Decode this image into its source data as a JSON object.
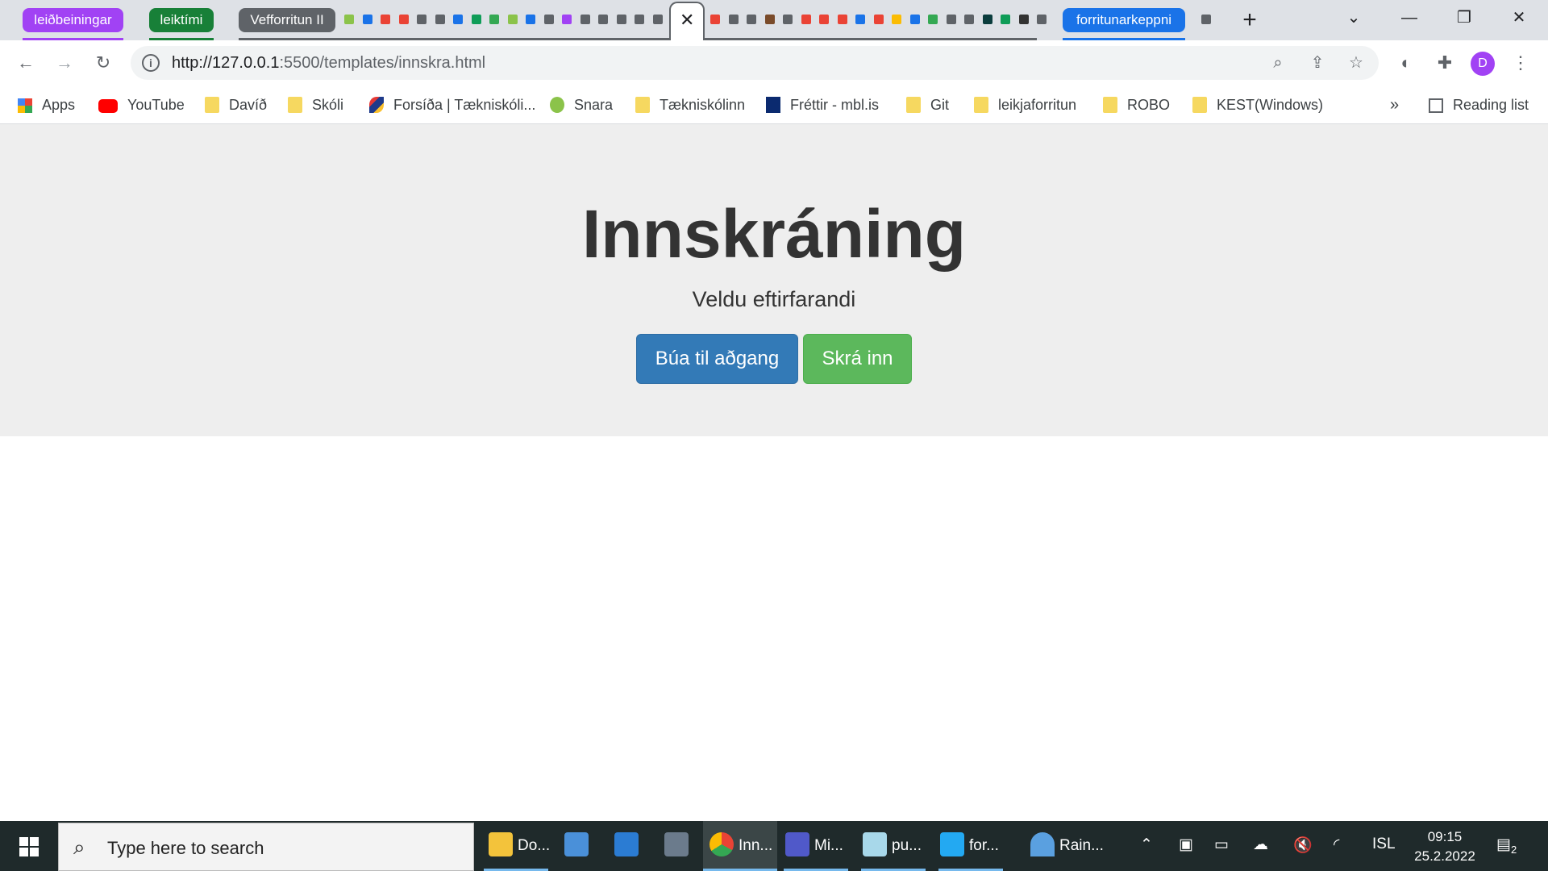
{
  "tab_groups": [
    {
      "label": "leiðbeiningar",
      "color": "#a142f4"
    },
    {
      "label": "leiktími",
      "color": "#188038"
    },
    {
      "label": "Vefforritun II",
      "color": "#5f6368"
    },
    {
      "label": "forritunarkeppni",
      "color": "#1a73e8"
    }
  ],
  "window_controls": {
    "tab_search": "⌄",
    "minimize": "—",
    "restore": "❐",
    "close": "✕"
  },
  "active_tab_close": "✕",
  "new_tab": "+",
  "toolbar": {
    "back": "←",
    "forward": "→",
    "reload": "↻",
    "url_host": "http://127.0.0.1",
    "url_rest": ":5500/templates/innskra.html",
    "avatar_letter": "D",
    "menu": "⋮"
  },
  "bookmarks": [
    {
      "label": "Apps",
      "icon": "apps-grid-icon"
    },
    {
      "label": "YouTube",
      "icon": "youtube-icon"
    },
    {
      "label": "Davíð",
      "icon": "folder-icon"
    },
    {
      "label": "Skóli",
      "icon": "folder-icon"
    },
    {
      "label": "Forsíða | Tækniskóli...",
      "icon": "tskoli-icon"
    },
    {
      "label": "Snara",
      "icon": "snara-icon"
    },
    {
      "label": "Tækniskólinn",
      "icon": "folder-icon"
    },
    {
      "label": "Fréttir - mbl.is",
      "icon": "mbl-icon"
    },
    {
      "label": "Git",
      "icon": "folder-icon"
    },
    {
      "label": "leikjaforritun",
      "icon": "folder-icon"
    },
    {
      "label": "ROBO",
      "icon": "folder-icon"
    },
    {
      "label": "KEST(Windows)",
      "icon": "folder-icon"
    }
  ],
  "bookmarks_overflow": "»",
  "reading_list": "Reading list",
  "page": {
    "title": "Innskráning",
    "subtitle": "Veldu eftirfarandi",
    "buttons": {
      "register": "Búa til aðgang",
      "login": "Skrá inn"
    }
  },
  "taskbar": {
    "search_placeholder": "Type here to search",
    "apps": [
      {
        "label": "Do...",
        "icon": "file-explorer-icon"
      },
      {
        "label": "",
        "icon": "store-lock-icon"
      },
      {
        "label": "",
        "icon": "calendar-icon"
      },
      {
        "label": "",
        "icon": "calculator-icon"
      },
      {
        "label": "Inn...",
        "icon": "chrome-icon"
      },
      {
        "label": "Mi...",
        "icon": "teams-icon"
      },
      {
        "label": "pu...",
        "icon": "notepad-icon"
      },
      {
        "label": "for...",
        "icon": "vscode-icon"
      }
    ],
    "weather": "Rain...",
    "language": "ISL",
    "time": "09:15",
    "date": "25.2.2022",
    "notifications": "2"
  }
}
